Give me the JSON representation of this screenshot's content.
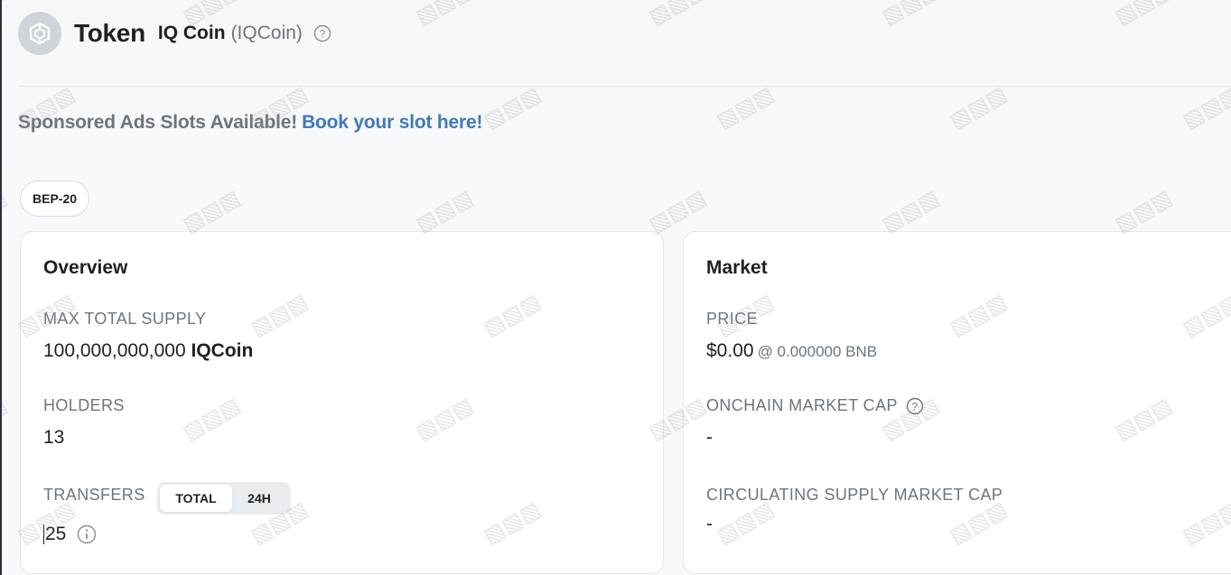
{
  "header": {
    "title": "Token",
    "token_name": "IQ Coin",
    "token_symbol": "(IQCoin)",
    "logo_icon": "bnb-cube-icon",
    "help_icon": "question-circle-icon"
  },
  "sponsor": {
    "text": "Sponsored Ads Slots Available!",
    "link_text": "Book your slot here!"
  },
  "badge": {
    "label": "BEP-20"
  },
  "overview": {
    "title": "Overview",
    "max_supply_label": "MAX TOTAL SUPPLY",
    "max_supply_value": "100,000,000,000",
    "max_supply_unit": "IQCoin",
    "holders_label": "HOLDERS",
    "holders_value": "13",
    "transfers_label": "TRANSFERS",
    "transfers_tabs": [
      "TOTAL",
      "24H"
    ],
    "transfers_value": "25",
    "info_icon": "info-circle-icon"
  },
  "market": {
    "title": "Market",
    "price_label": "PRICE",
    "price_value": "$0.00",
    "price_sub": "@ 0.000000 BNB",
    "onchain_cap_label": "ONCHAIN MARKET CAP",
    "onchain_cap_value": "-",
    "circulating_cap_label": "CIRCULATING SUPPLY MARKET CAP",
    "circulating_cap_value": "-"
  },
  "colors": {
    "link": "#3f7ab8",
    "muted": "#6c757d",
    "text": "#1e2022"
  }
}
